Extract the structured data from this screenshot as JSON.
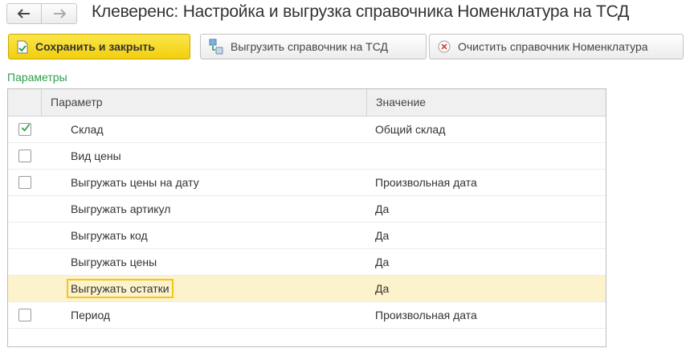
{
  "window": {
    "title": "Клеверенс: Настройка и выгрузка справочника Номенклатура на ТСД"
  },
  "toolbar": {
    "save_close_label": "Сохранить и закрыть",
    "upload_label": "Выгрузить справочник на ТСД",
    "clear_label": "Очистить справочник Номенклатура"
  },
  "params": {
    "group_label": "Параметры",
    "columns": [
      "Параметр",
      "Значение"
    ],
    "rows": [
      {
        "checkbox": "checked",
        "name": "Склад",
        "value": "Общий склад"
      },
      {
        "checkbox": "unchecked",
        "name": "Вид цены",
        "value": ""
      },
      {
        "checkbox": "unchecked",
        "name": "Выгружать цены на дату",
        "value": "Произвольная дата"
      },
      {
        "checkbox": "none",
        "name": "Выгружать артикул",
        "value": "Да"
      },
      {
        "checkbox": "none",
        "name": "Выгружать код",
        "value": "Да"
      },
      {
        "checkbox": "none",
        "name": "Выгружать цены",
        "value": "Да"
      },
      {
        "checkbox": "none",
        "name": "Выгружать остатки",
        "value": "Да",
        "selected": true
      },
      {
        "checkbox": "unchecked",
        "name": "Период",
        "value": "Произвольная дата"
      }
    ]
  },
  "colors": {
    "accent_green": "#2e9e4b",
    "primary_button": "#f6d92a",
    "selected_row": "#fcf2cc",
    "focus_border": "#f5c518"
  }
}
